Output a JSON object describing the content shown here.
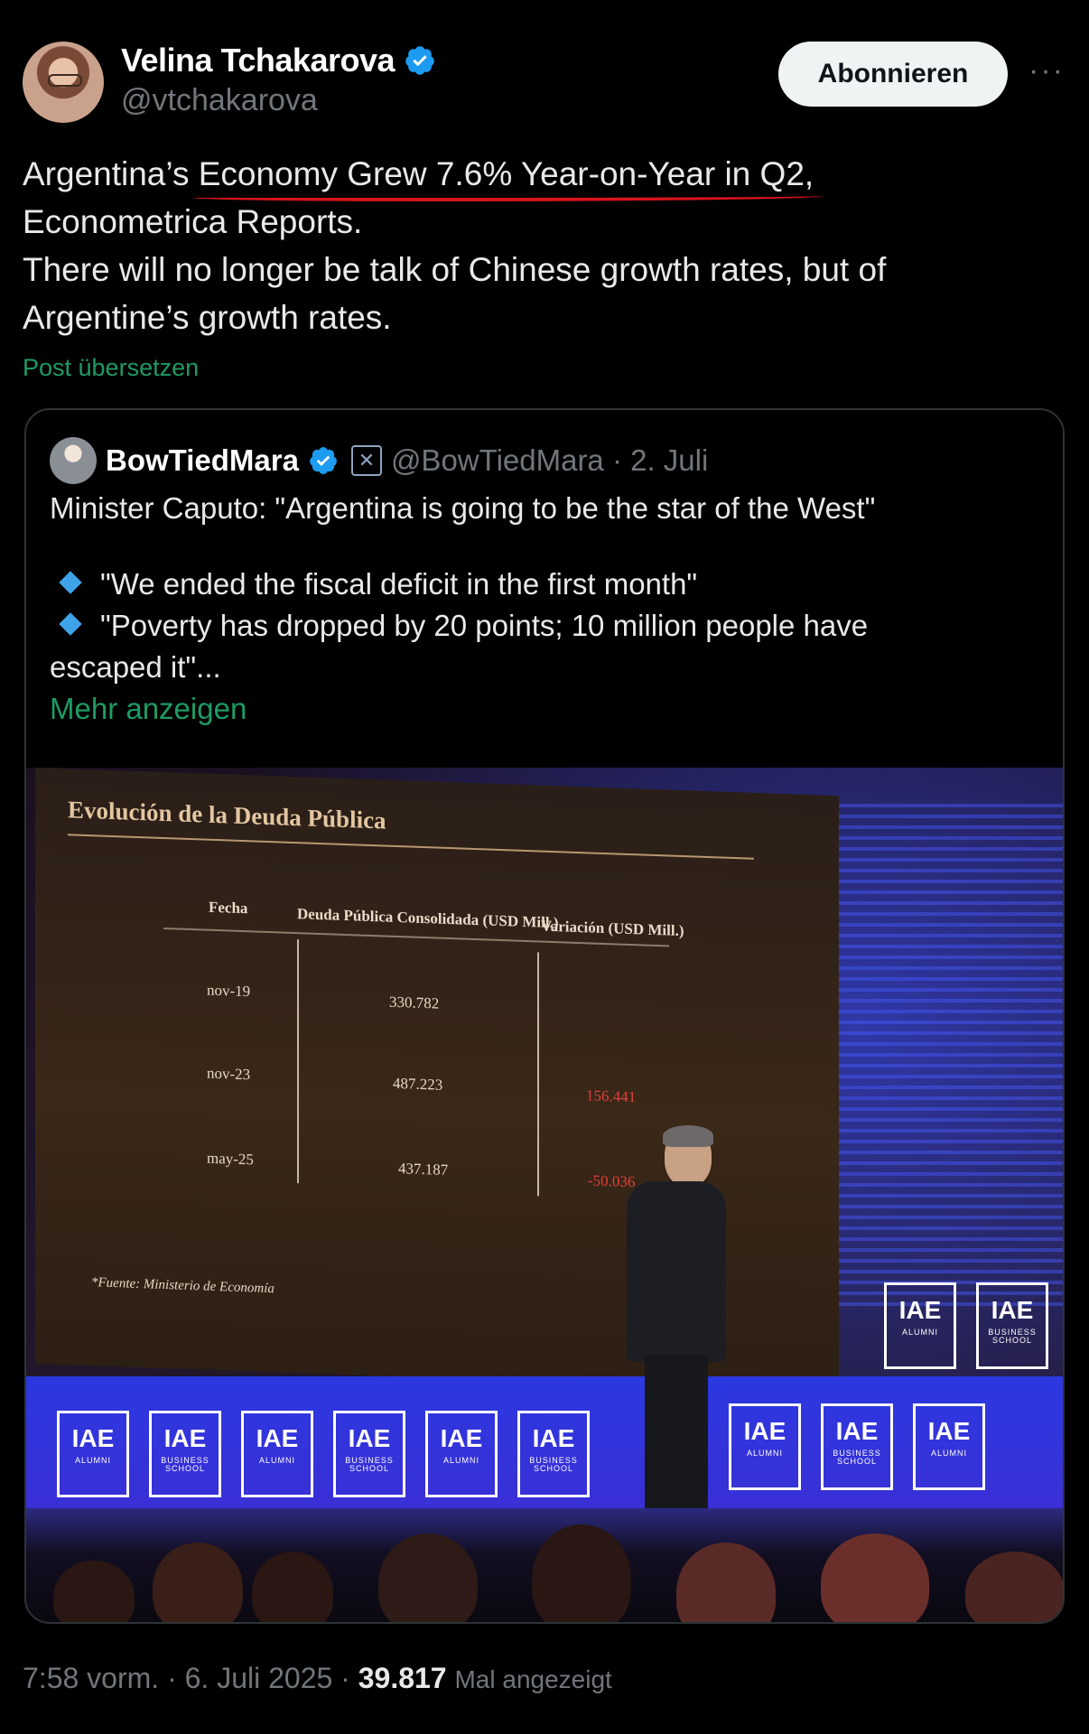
{
  "author": {
    "name": "Velina Tchakarova",
    "handle": "@vtchakarova"
  },
  "header": {
    "subscribe_label": "Abonnieren",
    "more_label": "···"
  },
  "tweet": {
    "line1_prefix": "Argentina’s ",
    "line1_highlight": "Economy Grew 7.6% Year-on-Year in Q2,",
    "line2": "Econometrica Reports.",
    "line3": "There will no longer be talk of Chinese growth rates, but of",
    "line4": "Argentine’s growth rates.",
    "translate_label": "Post übersetzen"
  },
  "quote": {
    "name": "BowTiedMara",
    "x_badge": "✕",
    "handle_date": "@BowTiedMara · 2. Juli",
    "headline": "Minister Caputo: \"Argentina is going to be the star of the West\"",
    "bullet1": "\"We ended the fiscal deficit in the first month\"",
    "bullet2": "\"Poverty has dropped by 20 points; 10 million people have",
    "bullet2_cont": "escaped it\"...",
    "show_more": "Mehr anzeigen"
  },
  "slide": {
    "title": "Evolución de la Deuda Pública",
    "col_fecha": "Fecha",
    "col_deuda": "Deuda Pública Consolidada (USD Mill.)",
    "col_variacion": "Variación (USD Mill.)",
    "rows": [
      {
        "fecha": "nov-19",
        "deuda": "330.782",
        "variacion": ""
      },
      {
        "fecha": "nov-23",
        "deuda": "487.223",
        "variacion": "156.441"
      },
      {
        "fecha": "may-25",
        "deuda": "437.187",
        "variacion": "-50.036"
      }
    ],
    "source": "*Fuente: Ministerio de Economía",
    "logo_text": "IAE",
    "logo_sub_alumni": "ALUMNI",
    "logo_sub_school": "BUSINESS SCHOOL"
  },
  "footer": {
    "time_date": "7:58 vorm. · 6. Juli 2025 · ",
    "views": "39.817",
    "views_label": "Mal angezeigt"
  },
  "colors": {
    "background": "#000000",
    "link_green": "#1d9b63",
    "verified_blue": "#1d9bf0",
    "underline_red": "#d9141c"
  }
}
